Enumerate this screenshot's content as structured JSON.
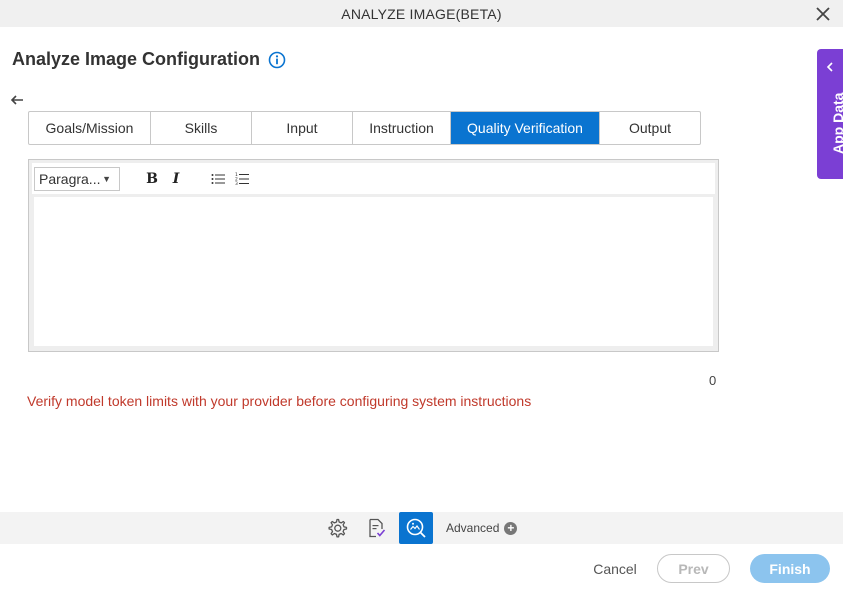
{
  "window": {
    "title": "ANALYZE IMAGE(BETA)",
    "close_icon": "close-icon"
  },
  "page": {
    "title": "Analyze Image Configuration",
    "info_icon": "info-icon",
    "back_icon": "arrow-left-icon"
  },
  "tabs": [
    {
      "label": "Goals/Mission",
      "active": false
    },
    {
      "label": "Skills",
      "active": false
    },
    {
      "label": "Input",
      "active": false
    },
    {
      "label": "Instruction",
      "active": false
    },
    {
      "label": "Quality Verification",
      "active": true
    },
    {
      "label": "Output",
      "active": false
    }
  ],
  "editor": {
    "format_select": "Paragra...",
    "bold_label": "B",
    "italic_label": "I",
    "bullet_list_icon": "bulleted-list-icon",
    "numbered_list_icon": "numbered-list-icon",
    "content": "",
    "char_count": "0"
  },
  "warning": "Verify model token limits with your provider before configuring system instructions",
  "side_panel": {
    "label": "App Data",
    "icon": "chevron-left-icon"
  },
  "bottom_bar": {
    "icons": [
      "settings-icon",
      "document-check-icon",
      "image-search-icon"
    ],
    "advanced_label": "Advanced",
    "advanced_icon": "plus-circle-icon"
  },
  "actions": {
    "cancel": "Cancel",
    "prev": "Prev",
    "finish": "Finish"
  },
  "colors": {
    "accent": "#0a74d0",
    "side_panel": "#7b3fd4",
    "warning": "#c0392b",
    "finish_button": "#8cc4ee"
  }
}
